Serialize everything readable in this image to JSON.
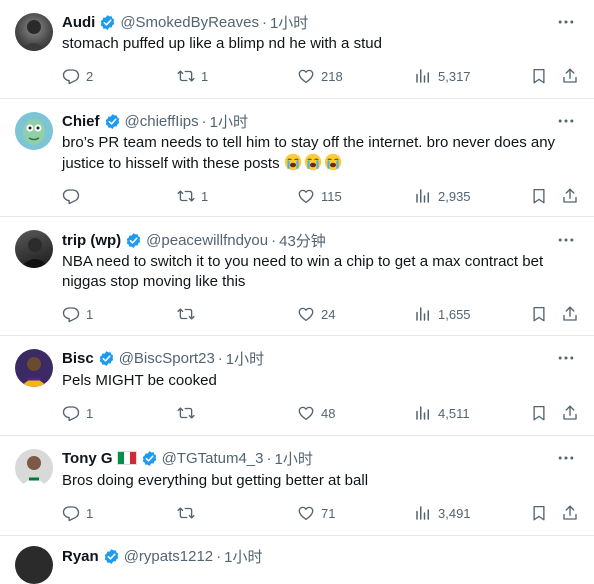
{
  "colors": {
    "verified": "#1d9bf0",
    "muted": "#536471",
    "text": "#0f1419",
    "divider": "#e6e9ec"
  },
  "tweets": [
    {
      "name": "Audi",
      "handle": "@SmokedByReaves",
      "time": "1小时",
      "text": "stomach puffed up like a blimp nd he with a stud",
      "replies": "2",
      "reposts": "1",
      "likes": "218",
      "views": "5,317"
    },
    {
      "name": "Chief",
      "handle": "@chieffIips",
      "time": "1小时",
      "text": "bro’s PR team needs to tell him to stay off the internet. bro never does any justice to hisself with these posts",
      "emoji": [
        "loudly-crying-face",
        "loudly-crying-face",
        "loudly-crying-face"
      ],
      "replies": "",
      "reposts": "1",
      "likes": "115",
      "views": "2,935"
    },
    {
      "name": "trip (wp)",
      "handle": "@peacewillfndyou",
      "time": "43分钟",
      "text": "NBA need to switch it to you need to win a chip to get a max contract bet niggas stop moving like this",
      "replies": "1",
      "reposts": "",
      "likes": "24",
      "views": "1,655"
    },
    {
      "name": "Bisc",
      "handle": "@BiscSport23",
      "time": "1小时",
      "text": "Pels MIGHT be cooked",
      "replies": "1",
      "reposts": "",
      "likes": "48",
      "views": "4,511"
    },
    {
      "name": "Tony G",
      "flag": "italy-flag",
      "handle": "@TGTatum4_3",
      "time": "1小时",
      "text": "Bros doing everything but getting better at ball",
      "replies": "1",
      "reposts": "",
      "likes": "71",
      "views": "3,491"
    },
    {
      "name": "Ryan",
      "handle": "@rypats1212",
      "time": "1小时"
    }
  ]
}
